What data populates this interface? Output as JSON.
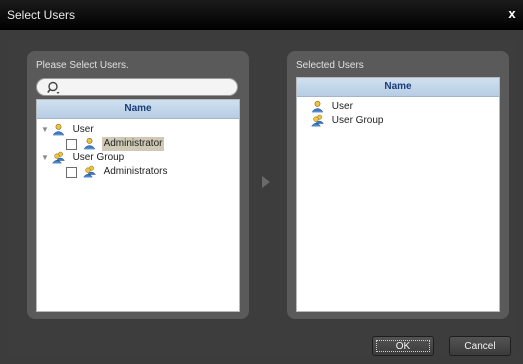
{
  "window": {
    "title": "Select Users",
    "close_label": "x"
  },
  "left_panel": {
    "caption": "Please Select Users.",
    "search": {
      "value": "",
      "placeholder": ""
    },
    "column_header": "Name",
    "tree": [
      {
        "label": "User",
        "type": "group-folder",
        "expanded": true,
        "children": [
          {
            "label": "Administrator",
            "checked": false,
            "highlighted": true
          }
        ]
      },
      {
        "label": "User Group",
        "type": "group-folder",
        "expanded": true,
        "children": [
          {
            "label": "Administrators",
            "checked": false,
            "highlighted": false
          }
        ]
      }
    ]
  },
  "right_panel": {
    "caption": "Selected Users",
    "column_header": "Name",
    "items": [
      "User",
      "User Group"
    ]
  },
  "buttons": {
    "ok": "OK",
    "cancel": "Cancel"
  },
  "icons": {
    "search": "search-icon",
    "user": "user-icon",
    "group": "user-group-icon",
    "expand": "expand-triangle-icon",
    "transfer": "transfer-arrow-icon"
  }
}
